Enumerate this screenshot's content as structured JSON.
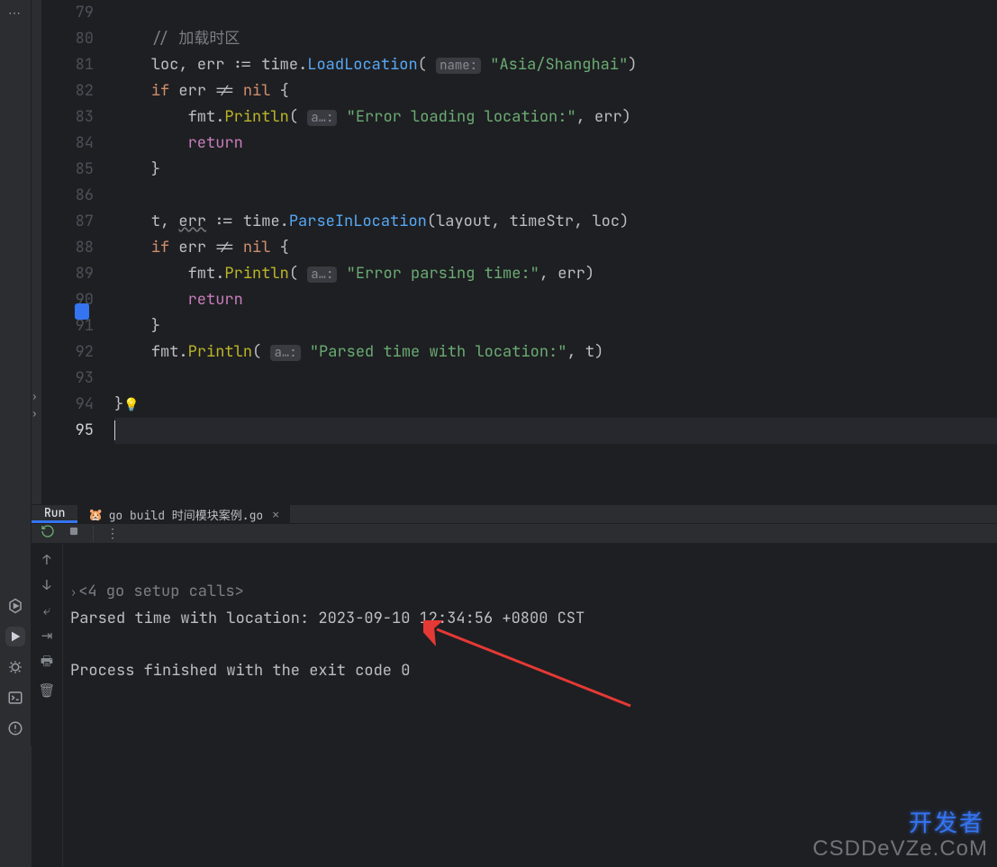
{
  "editor": {
    "lines": [
      {
        "n": 79,
        "html": ""
      },
      {
        "n": 80,
        "html": "    <span class='cmt'>// 加载时区</span>"
      },
      {
        "n": 81,
        "html": "    <span class='id'>loc</span>, <span class='id'>err</span> <span class='id'>:=</span> <span class='pkg'>time</span>.<span class='fn'>LoadLocation</span>( <span class='hint'>name:</span> <span class='str'>\"Asia/Shanghai\"</span>)"
      },
      {
        "n": 82,
        "html": "    <span class='kw'>if</span> <span class='id'>err</span> <span class='id'>!=</span> <span class='kw'>nil</span> {"
      },
      {
        "n": 83,
        "html": "        <span class='id'>fmt</span>.<span class='fn-y'>Println</span>( <span class='hint'>a…:</span> <span class='str'>\"Error loading location:\"</span>, <span class='id'>err</span>)"
      },
      {
        "n": 84,
        "html": "        <span class='kw2'>return</span>"
      },
      {
        "n": 85,
        "html": "    }"
      },
      {
        "n": 86,
        "html": ""
      },
      {
        "n": 87,
        "html": "    <span class='id'>t</span>, <span class='id under'>err</span> <span class='id'>:=</span> <span class='pkg'>time</span>.<span class='fn'>ParseInLocation</span>(<span class='id'>layout</span>, <span class='id'>timeStr</span>, <span class='id'>loc</span>)"
      },
      {
        "n": 88,
        "html": "    <span class='kw'>if</span> <span class='id'>err</span> <span class='id'>!=</span> <span class='kw'>nil</span> {"
      },
      {
        "n": 89,
        "html": "        <span class='id'>fmt</span>.<span class='fn-y'>Println</span>( <span class='hint'>a…:</span> <span class='str'>\"Error parsing time:\"</span>, <span class='id'>err</span>)"
      },
      {
        "n": 90,
        "html": "        <span class='kw2'>return</span>"
      },
      {
        "n": 91,
        "html": "    }"
      },
      {
        "n": 92,
        "html": "    <span class='id'>fmt</span>.<span class='fn-y'>Println</span>( <span class='hint'>a…:</span> <span class='str'>\"Parsed time with location:\"</span>, <span class='id'>t</span>)"
      },
      {
        "n": 93,
        "html": ""
      },
      {
        "n": 94,
        "html": "}<span class='bulb'>💡</span>"
      },
      {
        "n": 95,
        "html": "<span class='cursor'></span>",
        "current": true
      }
    ]
  },
  "panel": {
    "run_label": "Run",
    "build_tab": "go build 时间模块案例.go",
    "setup_line": "<4 go setup calls>",
    "output_line": "Parsed time with location: 2023-09-10 12:34:56 +0800 CST",
    "exit_line": "Process finished with the exit code 0"
  },
  "watermark": {
    "cn": "开发者",
    "en": "CSDDeVZe.CoM"
  }
}
